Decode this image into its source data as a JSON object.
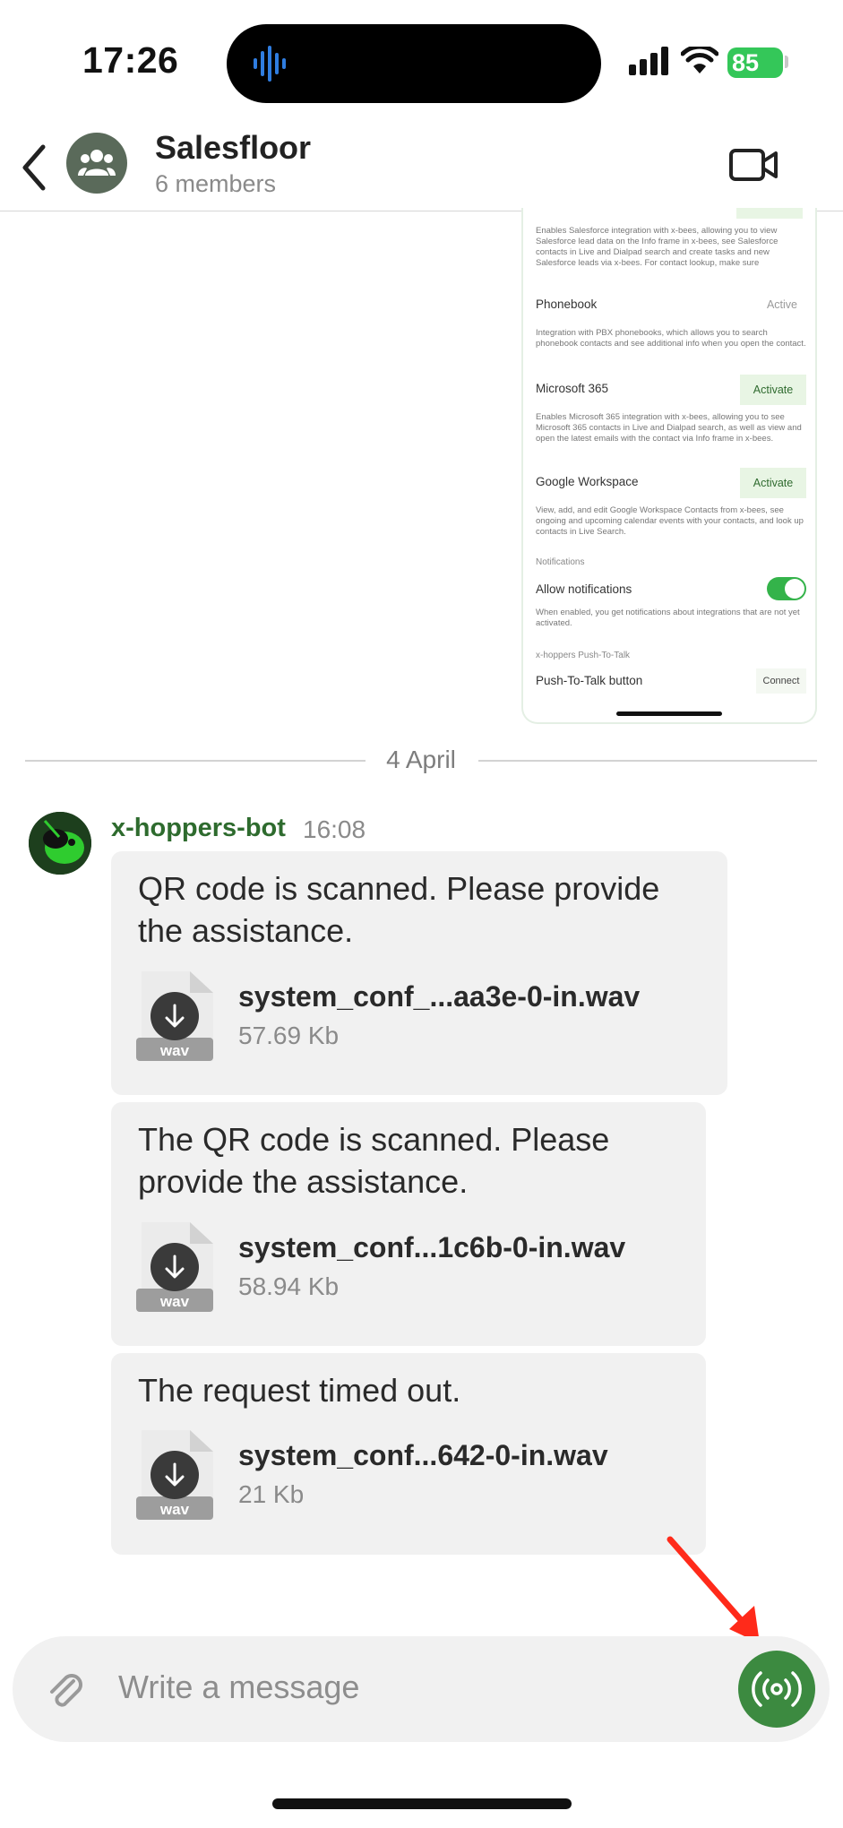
{
  "status_bar": {
    "time": "17:26",
    "battery": "85"
  },
  "header": {
    "title": "Salesfloor",
    "subtitle": "6 members"
  },
  "screenshot": {
    "top_desc": "Enables Salesforce integration with x-bees, allowing you to view Salesforce lead data on the Info frame in x-bees, see Salesforce contacts in Live and Dialpad search and create tasks and new Salesforce leads via x-bees. For contact lookup, make sure",
    "phonebook": {
      "title": "Phonebook",
      "status": "Active",
      "desc": "Integration with PBX phonebooks, which allows you to search phonebook contacts and see additional info when you open the contact."
    },
    "microsoft": {
      "title": "Microsoft 365",
      "action": "Activate",
      "desc": "Enables Microsoft 365 integration with x-bees, allowing you to see Microsoft 365 contacts in Live and Dialpad search, as well as view and open the latest emails with the contact via Info frame in x-bees."
    },
    "google": {
      "title": "Google Workspace",
      "action": "Activate",
      "desc": "View, add, and edit Google Workspace Contacts from x-bees, see ongoing and upcoming calendar events with your contacts, and look up contacts in Live Search."
    },
    "notifications_heading": "Notifications",
    "allow_notifications": {
      "title": "Allow notifications",
      "desc": "When enabled, you get notifications about integrations that are not yet activated.",
      "enabled": true
    },
    "ptt_heading": "x-hoppers Push-To-Talk",
    "ptt_row": {
      "title": "Push-To-Talk button",
      "action": "Connect"
    }
  },
  "date_divider": "4 April",
  "message": {
    "sender": "x-hoppers-bot",
    "time": "16:08",
    "bubbles": [
      {
        "text_line1": "QR code is scanned. Please provide",
        "text_line2": "the assistance.",
        "file_name": "system_conf_...aa3e-0-in.wav",
        "file_size": "57.69 Kb",
        "file_type": "wav"
      },
      {
        "text_line1": "The QR code is scanned. Please",
        "text_line2": "provide the assistance.",
        "file_name": "system_conf...1c6b-0-in.wav",
        "file_size": "58.94 Kb",
        "file_type": "wav"
      },
      {
        "text_line1": "The request timed out.",
        "file_name": "system_conf...642-0-in.wav",
        "file_size": "21 Kb",
        "file_type": "wav"
      }
    ]
  },
  "composer": {
    "placeholder": "Write a message"
  },
  "colors": {
    "accent": "#3c8a40",
    "sender": "#2e6b2e",
    "bubble": "#f1f1f1",
    "annotation_arrow": "#ff2a1a"
  },
  "icons": [
    "voice-wave-icon",
    "signal-icon",
    "wifi-icon",
    "back-chevron-icon",
    "group-icon",
    "video-camera-icon",
    "download-icon",
    "paperclip-icon",
    "push-to-talk-icon"
  ]
}
